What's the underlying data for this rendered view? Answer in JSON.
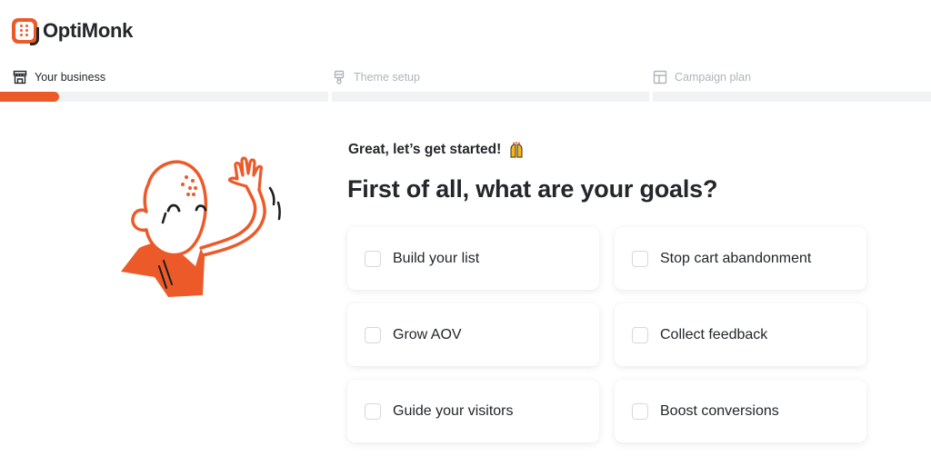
{
  "brand": {
    "name": "OptiMonk",
    "accent_color": "#ed5a29"
  },
  "steps": [
    {
      "label": "Your business",
      "icon": "store-icon",
      "state": "active",
      "progress_percent": 18
    },
    {
      "label": "Theme setup",
      "icon": "paintbrush-icon",
      "state": "inactive",
      "progress_percent": 0
    },
    {
      "label": "Campaign plan",
      "icon": "layout-icon",
      "state": "inactive",
      "progress_percent": 0
    }
  ],
  "main": {
    "intro": "Great, let’s get started!",
    "intro_emoji": "raising-hands-emoji",
    "title": "First of all, what are your goals?",
    "goals": [
      {
        "label": "Build your list",
        "checked": false
      },
      {
        "label": "Stop cart abandonment",
        "checked": false
      },
      {
        "label": "Grow AOV",
        "checked": false
      },
      {
        "label": "Collect feedback",
        "checked": false
      },
      {
        "label": "Guide your visitors",
        "checked": false
      },
      {
        "label": "Boost conversions",
        "checked": false
      }
    ]
  }
}
